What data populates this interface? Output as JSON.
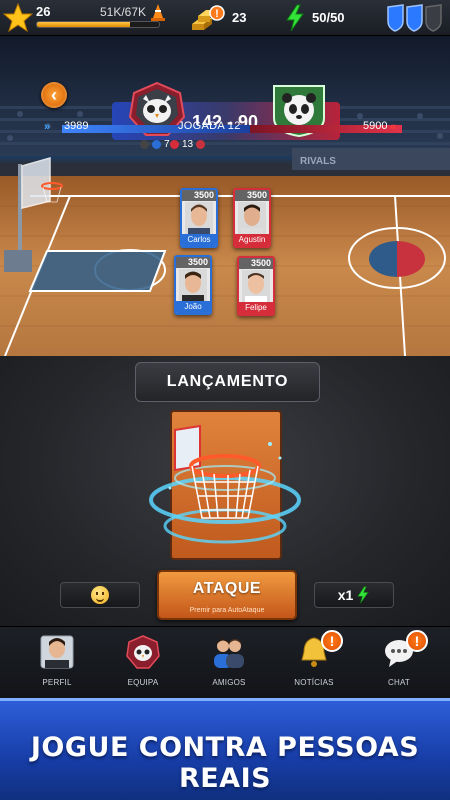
{
  "topbar": {
    "level": "26",
    "xp_text": "51K/67K",
    "xp_progress": 0.76,
    "gold": "23",
    "energy": "50/50"
  },
  "match": {
    "score": "142 - 90",
    "left_power": "3989",
    "right_power": "5900",
    "round_label": "JOGADA 12",
    "left_stat": "7",
    "right_stat": "13"
  },
  "players": [
    {
      "name": "Carlos",
      "rating": "3500",
      "team": "blue"
    },
    {
      "name": "Agustin",
      "rating": "3500",
      "team": "red"
    },
    {
      "name": "João",
      "rating": "3500",
      "team": "blue"
    },
    {
      "name": "Felipe",
      "rating": "3500",
      "team": "red"
    }
  ],
  "court_text": {
    "rivals": "RIVALS"
  },
  "action": {
    "title": "LANÇAMENTO",
    "attack_label": "ATAQUE",
    "attack_sub": "Premir para AutoAtaque",
    "multiplier": "x1"
  },
  "nav": {
    "items": [
      {
        "label": "PERFIL",
        "icon": "profile-avatar-icon"
      },
      {
        "label": "EQUIPA",
        "icon": "team-emblem-icon"
      },
      {
        "label": "AMIGOS",
        "icon": "friends-icon"
      },
      {
        "label": "NOTÍCIAS",
        "icon": "bell-icon"
      },
      {
        "label": "CHAT",
        "icon": "chat-bubble-icon"
      }
    ],
    "alert_symbol": "!"
  },
  "banner": {
    "text": "JOGUE CONTRA PESSOAS REAIS"
  },
  "colors": {
    "blue_team": "#2a6fd8",
    "red_team": "#d62d3a",
    "accent_orange": "#e0782a",
    "banner_blue": "#1f4ac0"
  }
}
